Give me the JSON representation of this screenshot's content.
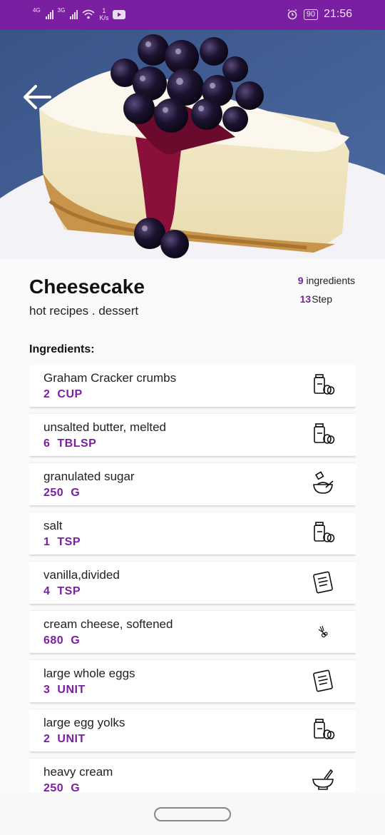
{
  "status": {
    "net_tag_1": "4G",
    "net_tag_2": "3G",
    "speed_value": "1",
    "speed_unit": "K/s",
    "battery": "90",
    "time": "21:56"
  },
  "recipe": {
    "title": "Cheesecake",
    "subtitle": "hot recipes . dessert",
    "ingredients_count": "9",
    "ingredients_label": "ingredients",
    "steps_count": "13",
    "steps_label": "Step"
  },
  "ingredients_heading": "Ingredients:",
  "ingredients": [
    {
      "name": "Graham Cracker crumbs",
      "amount": "2",
      "unit": "CUP",
      "icon": "jar-egg-icon"
    },
    {
      "name": "unsalted butter, melted",
      "amount": "6",
      "unit": "TBLSP",
      "icon": "jar-egg-icon"
    },
    {
      "name": "granulated sugar",
      "amount": "250",
      "unit": "G",
      "icon": "mixing-bowl-icon"
    },
    {
      "name": "salt",
      "amount": "1",
      "unit": "TSP",
      "icon": "jar-egg-icon"
    },
    {
      "name": "vanilla,divided",
      "amount": "4",
      "unit": "TSP",
      "icon": "recipe-card-icon"
    },
    {
      "name": "cream cheese, softened",
      "amount": "680",
      "unit": "G",
      "icon": "herb-icon"
    },
    {
      "name": "large whole eggs",
      "amount": "3",
      "unit": "UNIT",
      "icon": "recipe-card-icon"
    },
    {
      "name": "large egg yolks",
      "amount": "2",
      "unit": "UNIT",
      "icon": "jar-egg-icon"
    },
    {
      "name": "heavy cream",
      "amount": "250",
      "unit": "G",
      "icon": "mortar-pestle-icon"
    }
  ]
}
